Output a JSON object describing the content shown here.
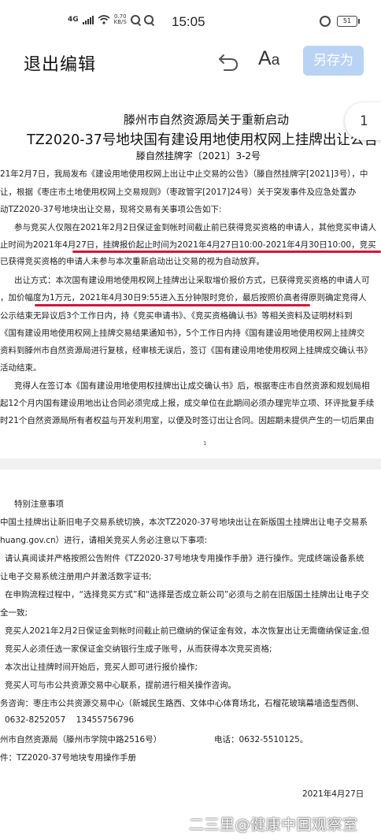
{
  "status_bar": {
    "network": "4G",
    "speed_value": "0.70",
    "speed_unit": "KB/S",
    "time": "15:05",
    "battery": "51",
    "icons": [
      "signal-icon",
      "wifi-icon",
      "app-q-icon",
      "app-q-icon",
      "alarm-icon",
      "battery-icon"
    ]
  },
  "toolbar": {
    "exit_label": "退出编辑",
    "undo_icon": "undo-icon",
    "font_label_big": "A",
    "font_label_small": "a",
    "save_as_label": "另存为",
    "save_as_color": "#b9d3f5"
  },
  "page_badge": "1",
  "doc": {
    "title_line1": "滕州市自然资源局关于重新启动",
    "title_line2": "TZ2020-37号地块国有建设用地使用权网上挂牌出让公告",
    "doc_number": "滕自然挂牌字〔2021〕3-2号",
    "page1_lines": [
      "21年2月7日，我局发布《建设用地使用权网上出让中止交易的公告》（滕自然挂牌字[2021]3号），中",
      "让，根据《枣庄市土地使用权网上交易规则》（枣政管字[2017]24号）关于突发事件及应急处置办",
      "动TZ2020-37号地块出让交易，现将交易有关事项公告如下:",
      "参与竞买人仅限在2021年2月2日保证金到帐时间截止前已获得竞买资格的申请人，其他竞买申请人",
      "止时间为2021年4月27日，挂牌报价起止时间为2021年4月27日10:00-2021年4月30日10:00，竞买",
      "已获得竞买资格的申请人未参与本次重新启动出让交易的视为自动放弃。",
      "出让方式：本次国有建设用地使用权网上挂牌出让采取增价报价方式，已获得竞买资格的申请人可",
      "，加价幅度为1万元，2021年4月30日9:55进入五分钟限时竞价，最后按照价高者得原则确定竞得人",
      "公示结束无异议后3个工作日内，持《竞买申请书》、《竞买资格确认书》等相关资料及证明材料到",
      "《国有建设用地使用权网上挂牌交易结果通知书》，5个工作日内持《国有建设用地使用权网上挂牌交",
      "资料到滕州市自然资源局进行复核，经审核无误后，签订《国有建设用地使用权网上挂牌成交确认书》",
      "活动结束。",
      "竞得人在签订本《国有建设用地使用权挂牌出让成交确认书》后，根据枣庄市自然资源和规划局相",
      "起12个月内国有建设用地出让合同必须完成上报，成交单位在此期间必须办理完毕立项、环评批复手续",
      "时21个自然资源局所有者权益与开发利用室，以便及时签订出让合同。因超期未提供产生的一切后果由"
    ],
    "page1_number": "1",
    "page2_lines": [
      "特别注意事项",
      "中国土挂牌出让新旧电子交易系统切换，本次TZ2020-37号地块出让在新版国土挂牌出让电子交易系",
      "huang.gov.cn）进行，请相关竞买人务必注意以下事项:",
      "请认真阅读并严格按照公告附件《TZ2020-37号地块专用操作手册》进行操作。完成终端设备系统",
      "让电子交易系统注册用户并激活数字证书;",
      "在申购流程过程中，“选择竞买方式”和“选择是否成立新公司”必须与之前在旧版国土挂牌出让电子交",
      "全一致;",
      "竞买人2021年2月2日保证金到帐时间截止前已缴纳的保证金有效，本次恢复出让无需缴纳保证金,但",
      "竞买人必须任选一家保证金交纳银行生成子账号，从而获得本次竞买资格;",
      "本次出让挂牌时间开始后，竞买人即可进行报价操作;",
      "竞买人可与市公共资源交易中心联系，提前进行相关操作咨询。",
      "务咨询：枣庄市公共资源交易中心（新城民生路西、文体中心体育场北，石榴花玻璃幕墙造型西侧、",
      "0632-8252057    13455756796",
      "州市自然资源局（滕州市学院中路2516号）",
      "电话：0632-5510125。",
      "件：TZ2020-37号地块专用操作手册",
      "2021年4月27日"
    ]
  },
  "watermark": "二三里@健康中国观察室",
  "highlight_color": "#d4163a"
}
